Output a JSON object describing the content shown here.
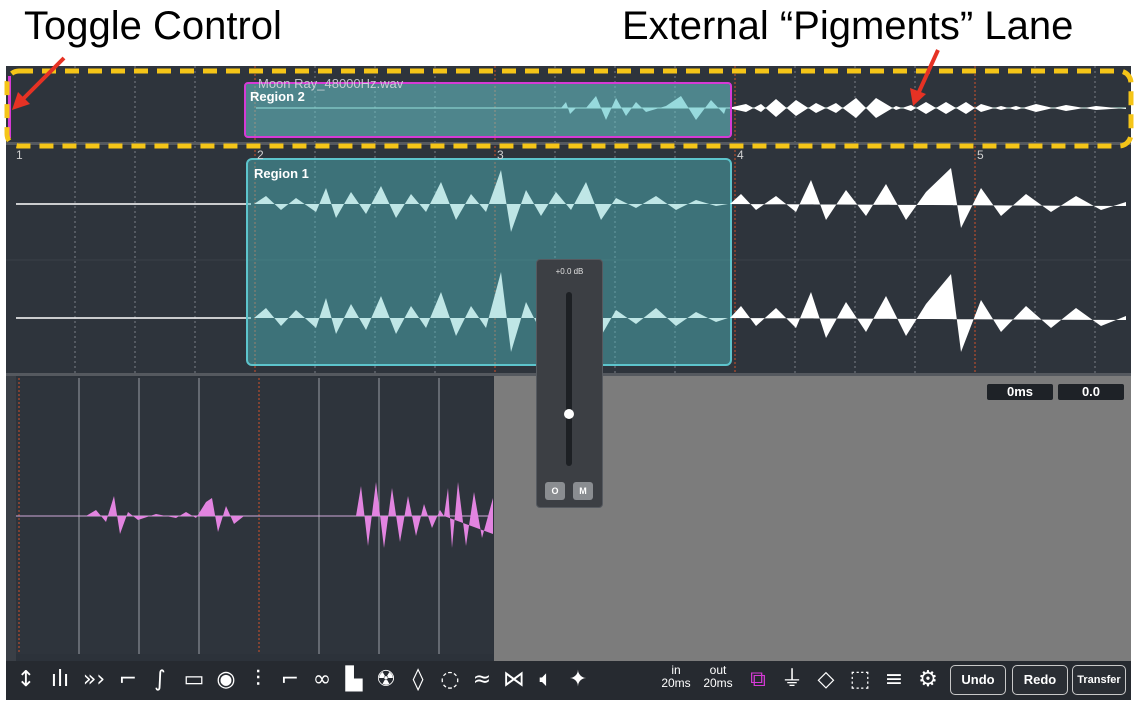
{
  "annotations": {
    "left": "Toggle Control",
    "right": "External “Pigments” Lane"
  },
  "top_lane": {
    "filename": "Moon Ray_48000Hz.wav",
    "region_label": "Region 2"
  },
  "main_track": {
    "region_label": "Region 1",
    "bar_markers": [
      "1",
      "2",
      "3",
      "4",
      "5"
    ]
  },
  "fader": {
    "gain_label": "+0.0 dB",
    "btn_o": "O",
    "btn_m": "M",
    "level": 0.3
  },
  "readouts": {
    "time": "0ms",
    "value": "0.0"
  },
  "toolbar": {
    "fade_in_label": "in",
    "fade_in_value": "20ms",
    "fade_out_label": "out",
    "fade_out_value": "20ms",
    "undo": "Undo",
    "redo": "Redo",
    "transfer": "Transfer",
    "icons": [
      "resize-vertical-icon",
      "waveform-icon",
      "fast-forward-icon",
      "fade-out-curve-icon",
      "fade-in-curve-icon",
      "tape-icon",
      "disc-icon",
      "pulse-icon",
      "step-icon",
      "linked-rings-icon",
      "bars-icon",
      "radioactive-icon",
      "crystal-icon",
      "dotted-circle-icon",
      "wave-icon",
      "bowtie-icon",
      "speaker-icon",
      "sparkle-icon"
    ],
    "right_icons": [
      "crop-icon",
      "funnel-icon",
      "diamond-icon",
      "marquee-icon",
      "lines-icon",
      "gear-icon"
    ]
  },
  "colors": {
    "accent_magenta": "#d63ad6",
    "region_teal": "#5dc4cc",
    "annotation_yellow": "#f5c518",
    "arrow_red": "#e63224",
    "pink_waveform": "#e284e0"
  }
}
